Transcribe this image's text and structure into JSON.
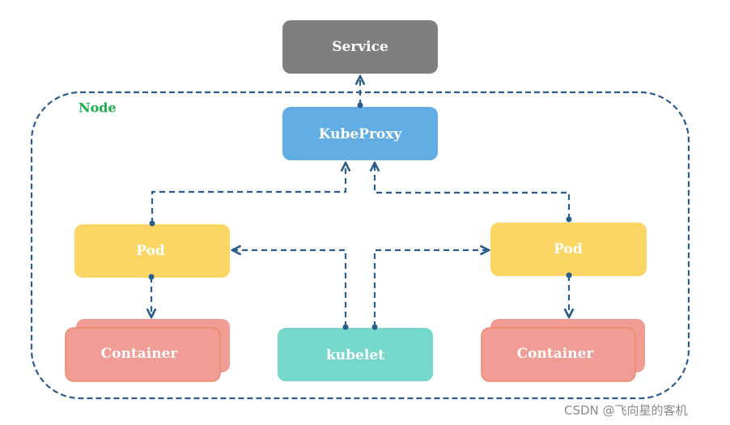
{
  "diagram": {
    "node_label": "Node",
    "service": "Service",
    "kubeproxy": "KubeProxy",
    "pod_left": "Pod",
    "pod_right": "Pod",
    "container_left": "Container",
    "container_right": "Container",
    "kubelet": "kubelet"
  },
  "colors": {
    "service": "#7f7f7f",
    "kubeproxy": "#62aee4",
    "pod": "#fbd664",
    "container": "#f29c96",
    "kubelet": "#76d7cb",
    "connector": "#2b5c8a",
    "node_label": "#1aae4a"
  },
  "watermark": "CSDN @飞向星的客机"
}
